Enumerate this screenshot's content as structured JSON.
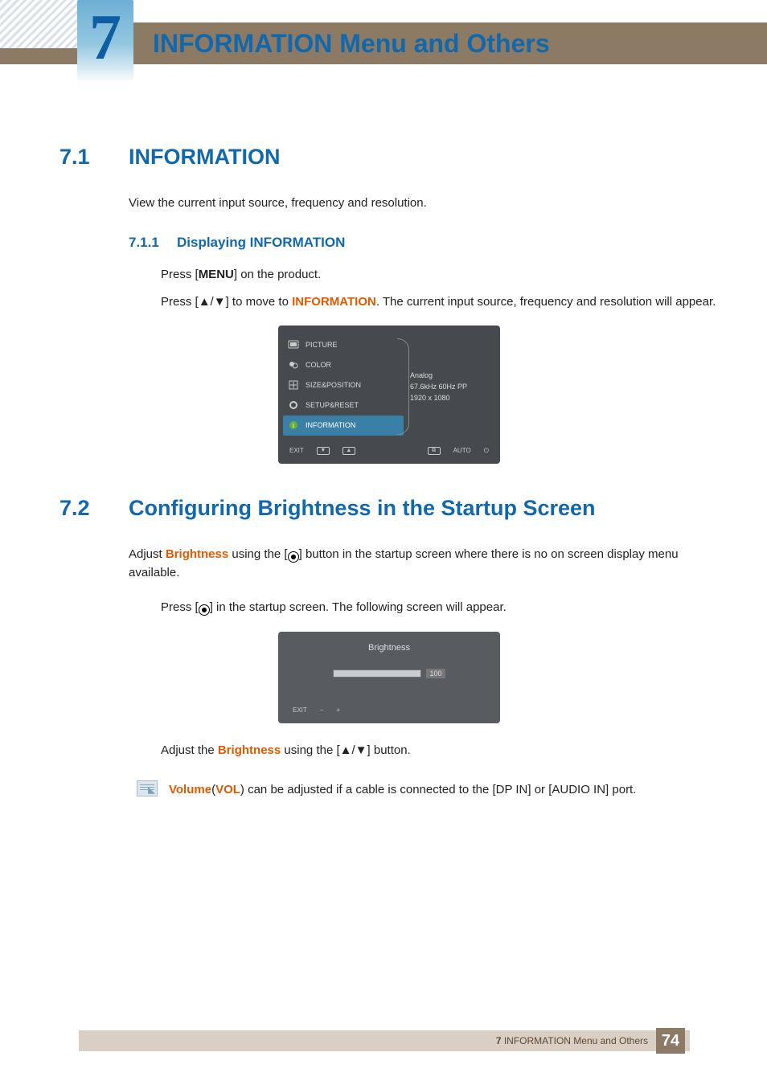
{
  "chapter": {
    "number": "7",
    "title": "INFORMATION Menu and Others"
  },
  "sec71": {
    "num": "7.1",
    "title": "INFORMATION",
    "intro": "View the current input source, frequency and resolution.",
    "sub": {
      "num": "7.1.1",
      "title": "Displaying INFORMATION"
    },
    "step1_a": "Press [",
    "step1_b": "MENU",
    "step1_c": "] on the product.",
    "step2_a": "Press [",
    "step2_b": "] to move to ",
    "step2_em": "INFORMATION",
    "step2_c": ". The current input source, frequency and resolution will appear."
  },
  "osd": {
    "menu": [
      "PICTURE",
      "COLOR",
      "SIZE&POSITION",
      "SETUP&RESET",
      "INFORMATION"
    ],
    "info": [
      "Analog",
      "67.6kHz 60Hz PP",
      "1920 x 1080"
    ],
    "foot_left": "EXIT",
    "foot_right": "AUTO"
  },
  "sec72": {
    "num": "7.2",
    "title": "Configuring Brightness in the Startup Screen",
    "para_a": "Adjust ",
    "para_em": "Brightness",
    "para_b": " using the [",
    "para_c": "] button in the startup screen where there is no on screen display menu available.",
    "step_a": "Press [",
    "step_b": "] in the startup screen. The following screen will appear.",
    "after_a": "Adjust the ",
    "after_em": "Brightness",
    "after_b": " using the [",
    "after_c": "] button."
  },
  "osd2": {
    "title": "Brightness",
    "value": "100",
    "exit": "EXIT"
  },
  "note": {
    "em1": "Volume",
    "paren_a": "(",
    "em2": "VOL",
    "paren_b": ")",
    "rest": " can be adjusted if a cable is connected to the [DP IN] or [AUDIO IN] port."
  },
  "footer": {
    "label": "INFORMATION Menu and Others",
    "chapter": "7",
    "page": "74"
  }
}
